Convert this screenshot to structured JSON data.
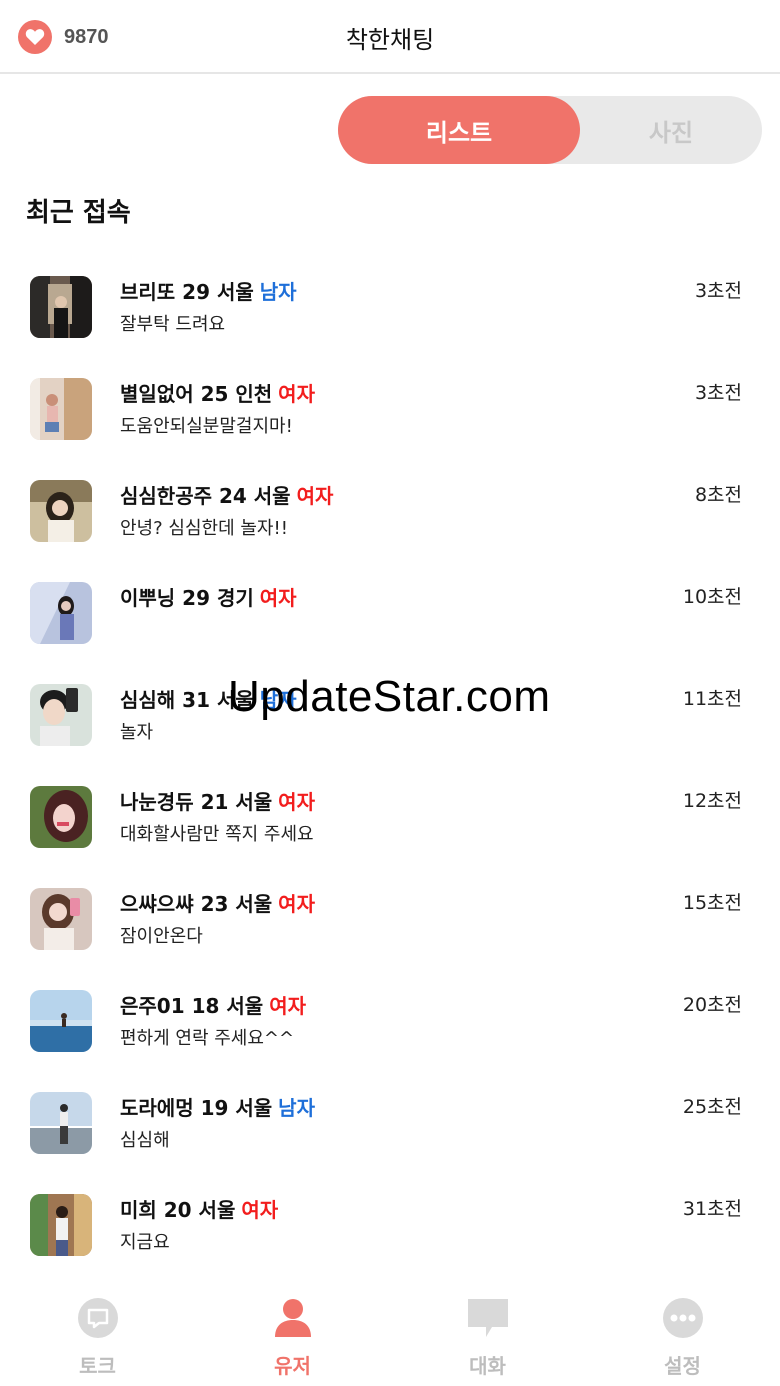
{
  "header": {
    "points": "9870",
    "title": "착한채팅",
    "icons": {
      "points": "heart-icon"
    }
  },
  "toggle": {
    "active": "리스트",
    "inactive": "사진"
  },
  "section": {
    "title": "최근 접속"
  },
  "users": [
    {
      "name": "브리또 29 서울",
      "gender": "남자",
      "gender_type": "male",
      "message": "잘부탁 드려요",
      "time": "3초전"
    },
    {
      "name": "별일없어 25 인천",
      "gender": "여자",
      "gender_type": "female",
      "message": "도움안되실분말걸지마!",
      "time": "3초전"
    },
    {
      "name": "심심한공주 24 서울",
      "gender": "여자",
      "gender_type": "female",
      "message": "안녕? 심심한데 놀자!!",
      "time": "8초전"
    },
    {
      "name": "이뿌닝 29 경기",
      "gender": "여자",
      "gender_type": "female",
      "message": "",
      "time": "10초전"
    },
    {
      "name": "심심해 31 서울",
      "gender": "남자",
      "gender_type": "male",
      "message": "놀자",
      "time": "11초전"
    },
    {
      "name": "나눈경듀 21 서울",
      "gender": "여자",
      "gender_type": "female",
      "message": "대화할사람만 쪽지 주세요",
      "time": "12초전"
    },
    {
      "name": "으쌰으쌰 23 서울",
      "gender": "여자",
      "gender_type": "female",
      "message": "잠이안온다",
      "time": "15초전"
    },
    {
      "name": "은주01 18 서울",
      "gender": "여자",
      "gender_type": "female",
      "message": "편하게 연락 주세요^^",
      "time": "20초전"
    },
    {
      "name": "도라에멍 19 서울",
      "gender": "남자",
      "gender_type": "male",
      "message": "심심해",
      "time": "25초전"
    },
    {
      "name": "미희 20 서울",
      "gender": "여자",
      "gender_type": "female",
      "message": "지금요",
      "time": "31초전"
    }
  ],
  "watermark": "UpdateStar.com",
  "nav": [
    {
      "label": "토크",
      "icon": "talk-bubble-icon",
      "active": false
    },
    {
      "label": "유저",
      "icon": "user-icon",
      "active": true
    },
    {
      "label": "대화",
      "icon": "chat-icon",
      "active": false
    },
    {
      "label": "설정",
      "icon": "more-dots-icon",
      "active": false
    }
  ],
  "colors": {
    "accent": "#f0736a",
    "male": "#1e6fd9",
    "female": "#f21d1d",
    "inactive": "#bdbdbd",
    "toggle_bg": "#e9e9e9"
  }
}
